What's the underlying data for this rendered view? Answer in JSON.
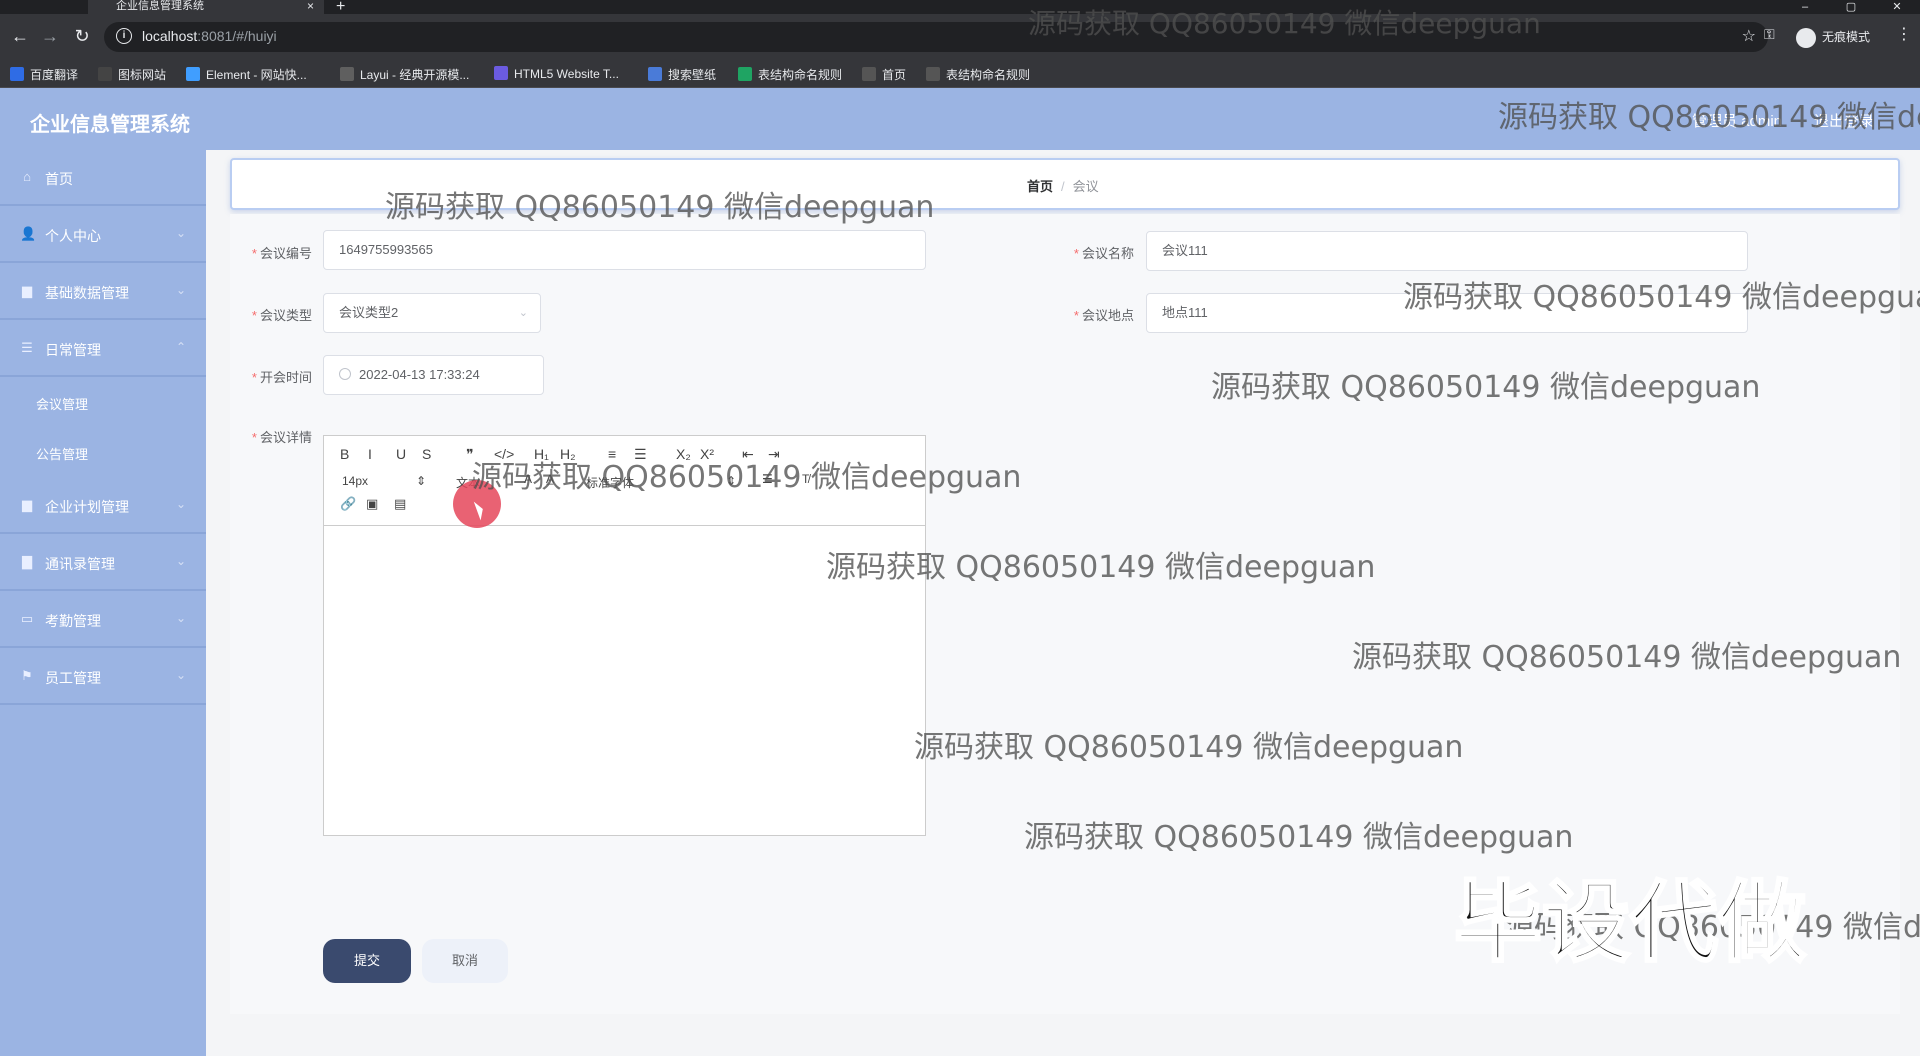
{
  "browser": {
    "tab_title": "企业信息管理系统",
    "tab_close": "×",
    "new_tab": "+",
    "url_host": "localhost",
    "url_path": ":8081/#/huiyi",
    "incognito_label": "无痕模式",
    "bookmarks": [
      {
        "label": "百度翻译",
        "color": "#2f6ce5"
      },
      {
        "label": "图标网站",
        "color": "#444"
      },
      {
        "label": "Element - 网站快...",
        "color": "#409eff"
      },
      {
        "label": "Layui - 经典开源模...",
        "color": "#5f5f5f"
      },
      {
        "label": "HTML5 Website T...",
        "color": "#6b5be0"
      },
      {
        "label": "搜索壁纸",
        "color": "#4a7bd8"
      },
      {
        "label": "表结构命名规则",
        "color": "#1fa463"
      },
      {
        "label": "首页",
        "color": "#555"
      },
      {
        "label": "表结构命名规则",
        "color": "#555"
      }
    ]
  },
  "header": {
    "app_title": "企业信息管理系统",
    "user_text": "管理员 admin",
    "logout": "退出登录"
  },
  "sidebar": {
    "items": [
      {
        "label": "首页",
        "icon": "home-icon",
        "glyph": "⌂",
        "arrow": ""
      },
      {
        "label": "个人中心",
        "icon": "user-icon",
        "glyph": "👤",
        "arrow": "⌄"
      },
      {
        "label": "基础数据管理",
        "icon": "briefcase-icon",
        "glyph": "▆",
        "arrow": "⌄"
      },
      {
        "label": "日常管理",
        "icon": "list-icon",
        "glyph": "☰",
        "arrow": "⌃"
      },
      {
        "label": "会议管理",
        "sub": true
      },
      {
        "label": "公告管理",
        "sub": true
      },
      {
        "label": "企业计划管理",
        "icon": "briefcase-icon",
        "glyph": "▆",
        "arrow": "⌄"
      },
      {
        "label": "通讯录管理",
        "icon": "book-icon",
        "glyph": "▇",
        "arrow": "⌄"
      },
      {
        "label": "考勤管理",
        "icon": "monitor-icon",
        "glyph": "▭",
        "arrow": "⌄"
      },
      {
        "label": "员工管理",
        "icon": "flag-icon",
        "glyph": "⚑",
        "arrow": "⌄"
      }
    ]
  },
  "breadcrumb": {
    "home": "首页",
    "separator": "/",
    "current": "会议"
  },
  "form": {
    "meeting_no_label": "会议编号",
    "meeting_no_value": "1649755993565",
    "meeting_name_label": "会议名称",
    "meeting_name_value": "会议111",
    "meeting_type_label": "会议类型",
    "meeting_type_value": "会议类型2",
    "location_label": "会议地点",
    "location_value": "地点111",
    "start_time_label": "开会时间",
    "start_time_value": "2022-04-13 17:33:24",
    "detail_label": "会议详情",
    "required_mark": "*",
    "editor": {
      "row1": [
        "B",
        "I",
        "U",
        "S",
        "❞",
        "</>",
        "H₁",
        "H₂",
        "≡",
        "☰",
        "X₂",
        "X²",
        "⇤",
        "⇥"
      ],
      "font_size": "14px",
      "text_label": "文本",
      "font_label": "标准字体",
      "row3": [
        "🔗",
        "▣",
        "▤"
      ]
    },
    "submit": "提交",
    "cancel": "取消"
  },
  "watermarks": {
    "text": "源码获取 QQ86050149 微信deepguan",
    "text_cut1": "源码获取 QQ86050149 微信de",
    "text_cut2": "源码获取 QQ86050149 微信deepgua",
    "big": "毕设代做"
  }
}
